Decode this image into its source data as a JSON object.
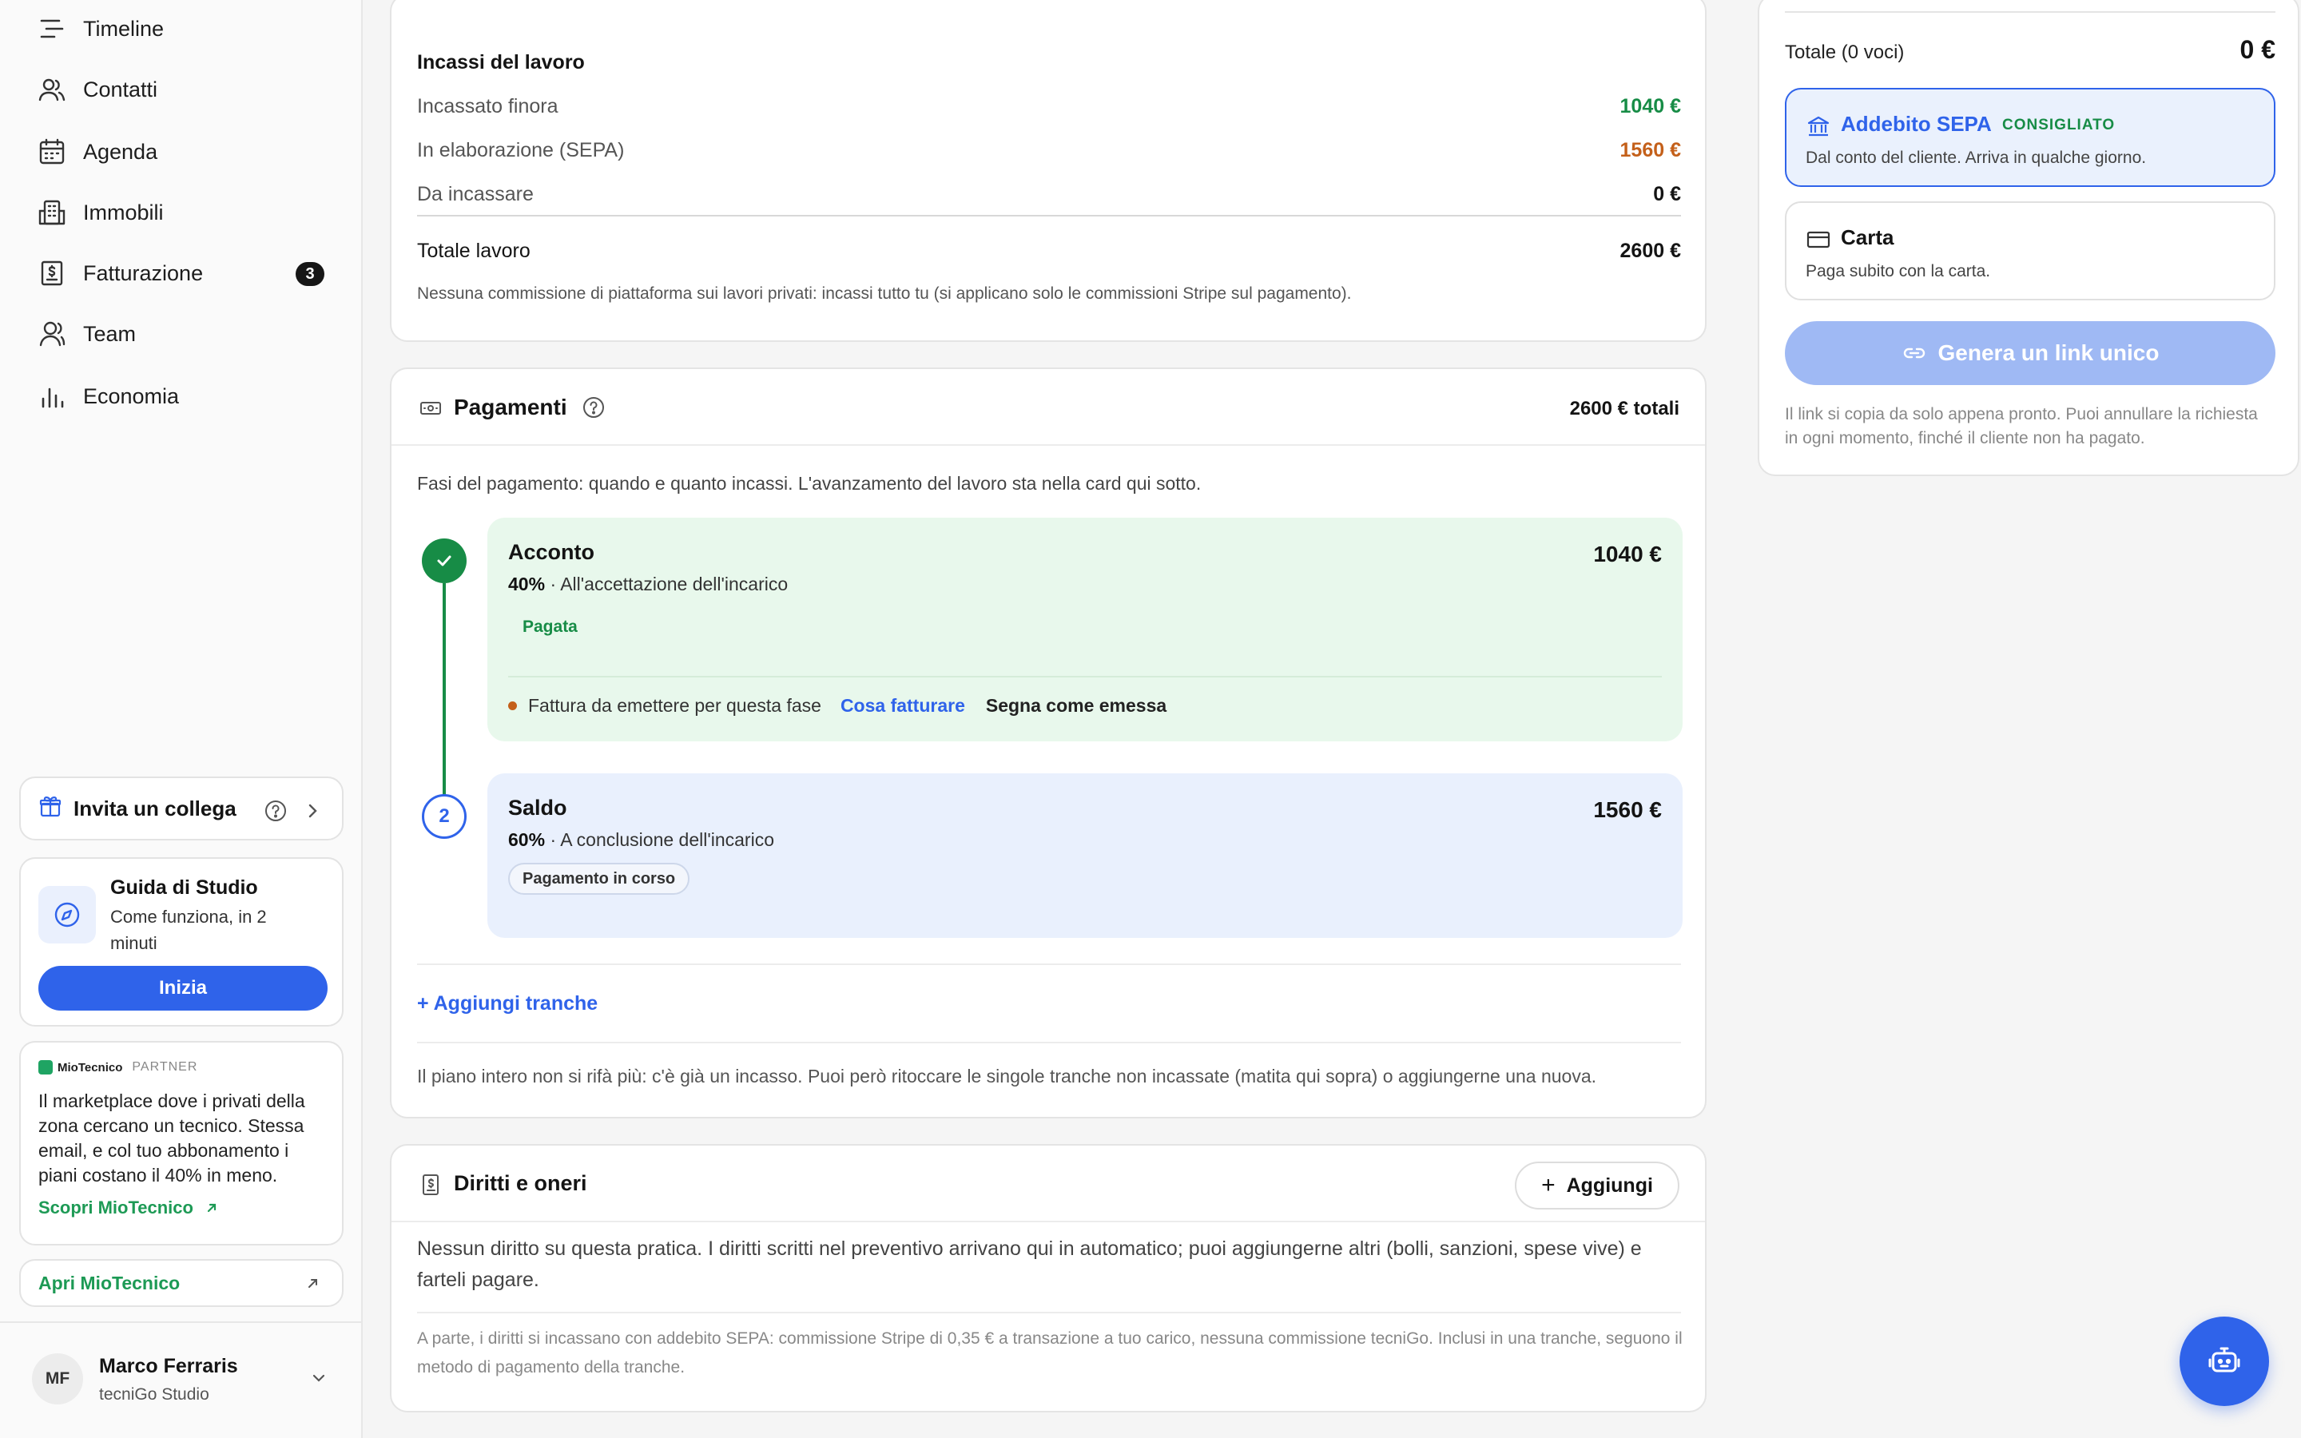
{
  "sidebar": {
    "nav": [
      {
        "label": "Timeline",
        "icon": "timeline-icon"
      },
      {
        "label": "Contatti",
        "icon": "contacts-icon"
      },
      {
        "label": "Agenda",
        "icon": "calendar-icon"
      },
      {
        "label": "Immobili",
        "icon": "building-icon"
      },
      {
        "label": "Fatturazione",
        "icon": "invoice-icon",
        "badge": "3"
      },
      {
        "label": "Team",
        "icon": "team-icon"
      },
      {
        "label": "Economia",
        "icon": "chart-icon"
      }
    ],
    "invite": {
      "label": "Invita un collega"
    },
    "guide": {
      "title": "Guida di Studio",
      "subtitle": "Come funziona, in 2 minuti",
      "button": "Inizia"
    },
    "partner": {
      "brand": "MioTecnico",
      "tag": "PARTNER",
      "text": "Il marketplace dove i privati della zona cercano un tecnico. Stessa email, e col tuo abbonamento i piani costano il 40% in meno.",
      "link": "Scopri MioTecnico",
      "open": "Apri MioTecnico"
    },
    "user": {
      "initials": "MF",
      "name": "Marco Ferraris",
      "studio": "tecniGo Studio"
    }
  },
  "income": {
    "title": "Incassi del lavoro",
    "rows": [
      {
        "label": "Incassato finora",
        "value": "1040 €",
        "color": "#178c46"
      },
      {
        "label": "In elaborazione (SEPA)",
        "value": "1560 €",
        "color": "#c4601a"
      },
      {
        "label": "Da incassare",
        "value": "0 €",
        "color": "#141414"
      }
    ],
    "total_label": "Totale lavoro",
    "total_value": "2600 €",
    "note": "Nessuna commissione di piattaforma sui lavori privati: incassi tutto tu (si applicano solo le commissioni Stripe sul pagamento)."
  },
  "payments": {
    "title": "Pagamenti",
    "total": "2600 € totali",
    "intro": "Fasi del pagamento: quando e quanto incassi. L'avanzamento del lavoro sta nella card qui sotto.",
    "stages": [
      {
        "name": "Acconto",
        "amount": "1040 €",
        "percent": "40%",
        "desc": "· All'accettazione dell'incarico",
        "status": "Pagata"
      },
      {
        "number": "2",
        "name": "Saldo",
        "amount": "1560 €",
        "percent": "60%",
        "desc": "· A conclusione dell'incarico",
        "status": "Pagamento in corso"
      }
    ],
    "invoice_note": "Fattura da emettere per questa fase",
    "invoice_link": "Cosa fatturare",
    "invoice_mark": "Segna come emessa",
    "add_tranche": "+ Aggiungi tranche",
    "footer": "Il piano intero non si rifà più: c'è già un incasso. Puoi però ritoccare le singole tranche non incassate (matita qui sopra) o aggiungerne una nuova."
  },
  "rights": {
    "title": "Diritti e oneri",
    "add": "Aggiungi",
    "text": "Nessun diritto su questa pratica. I diritti scritti nel preventivo arrivano qui in automatico; puoi aggiungerne altri (bolli, sanzioni, spese vive) e farteli pagare.",
    "note": "A parte, i diritti si incassano con addebito SEPA: commissione Stripe di 0,35 € a transazione a tuo carico, nessuna commissione tecniGo. Inclusi in una tranche, seguono il metodo di pagamento della tranche."
  },
  "panel": {
    "total_label": "Totale (0 voci)",
    "total_value": "0 €",
    "sepa": {
      "title": "Addebito SEPA",
      "badge": "CONSIGLIATO",
      "subtitle": "Dal conto del cliente. Arriva in qualche giorno."
    },
    "card": {
      "title": "Carta",
      "subtitle": "Paga subito con la carta."
    },
    "button": "Genera un link unico",
    "note": "Il link si copia da solo appena pronto. Puoi annullare la richiesta in ogni momento, finché il cliente non ha pagato."
  },
  "colors": {
    "accent": "#2f63ea",
    "success": "#178c46",
    "warning": "#c4601a"
  }
}
